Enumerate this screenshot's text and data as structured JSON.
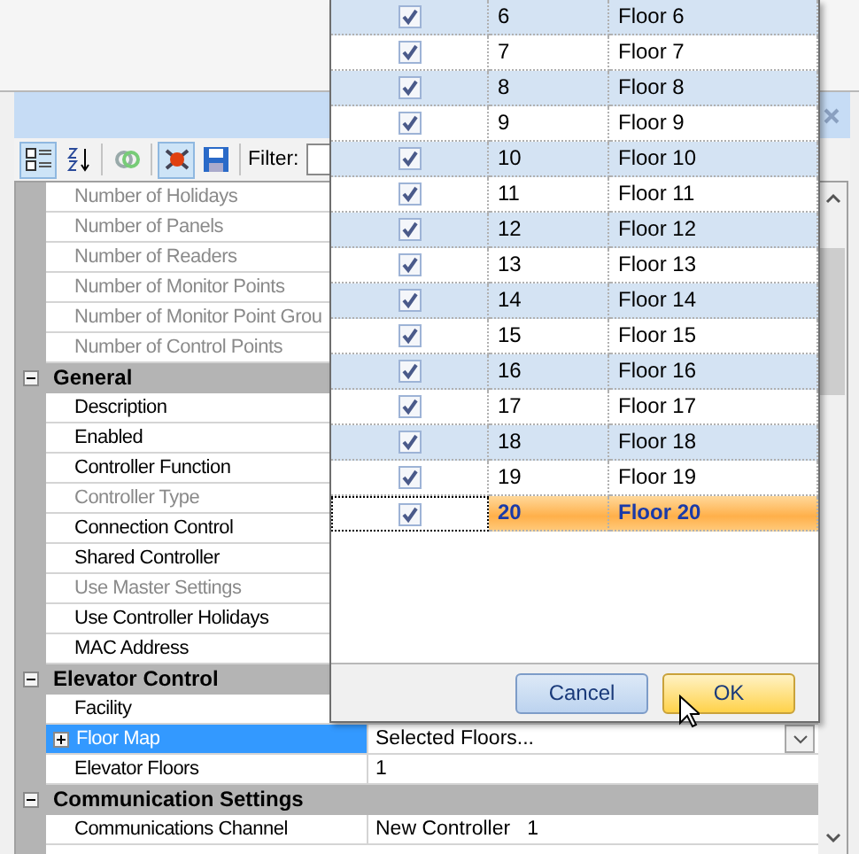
{
  "toolbar": {
    "buttons": [
      {
        "kind": "categorized",
        "selected": true
      },
      {
        "kind": "alphabetical",
        "selected": false
      },
      {
        "kind": "link",
        "selected": false
      },
      {
        "kind": "tools",
        "selected": true
      },
      {
        "kind": "save",
        "selected": false
      }
    ],
    "filter_label": "Filter:"
  },
  "property_grid": {
    "rows": [
      {
        "kind": "property",
        "label": "Number of Holidays",
        "disabled": true,
        "selected": false
      },
      {
        "kind": "property",
        "label": "Number of Panels",
        "disabled": true,
        "selected": false
      },
      {
        "kind": "property",
        "label": "Number of Readers",
        "disabled": true,
        "selected": false
      },
      {
        "kind": "property",
        "label": "Number of Monitor Points",
        "disabled": true,
        "selected": false
      },
      {
        "kind": "property",
        "label": "Number of Monitor Point Grou",
        "disabled": true,
        "selected": false
      },
      {
        "kind": "property",
        "label": "Number of Control Points",
        "disabled": true,
        "selected": false
      },
      {
        "kind": "category",
        "label": "General",
        "expanded": true
      },
      {
        "kind": "property",
        "label": "Description",
        "disabled": false,
        "selected": false
      },
      {
        "kind": "property",
        "label": "Enabled",
        "disabled": false,
        "selected": false
      },
      {
        "kind": "property",
        "label": "Controller Function",
        "disabled": false,
        "selected": false
      },
      {
        "kind": "property",
        "label": "Controller Type",
        "disabled": true,
        "selected": false
      },
      {
        "kind": "property",
        "label": "Connection Control",
        "disabled": false,
        "selected": false
      },
      {
        "kind": "property",
        "label": "Shared Controller",
        "disabled": false,
        "selected": false
      },
      {
        "kind": "property",
        "label": "Use Master Settings",
        "disabled": true,
        "selected": false
      },
      {
        "kind": "property",
        "label": "Use Controller Holidays",
        "disabled": false,
        "selected": false
      },
      {
        "kind": "property",
        "label": "MAC Address",
        "disabled": false,
        "selected": false
      },
      {
        "kind": "category",
        "label": "Elevator Control",
        "expanded": true
      },
      {
        "kind": "property",
        "label": "Facility",
        "disabled": false,
        "selected": false
      },
      {
        "kind": "property",
        "label": "Floor Map",
        "disabled": false,
        "selected": true,
        "expanded": false,
        "value": "Selected Floors..."
      },
      {
        "kind": "property",
        "label": "Elevator Floors",
        "disabled": false,
        "selected": false,
        "value": "1"
      },
      {
        "kind": "category",
        "label": "Communication Settings",
        "expanded": true
      },
      {
        "kind": "property",
        "label": "Communications Channel",
        "disabled": false,
        "selected": false,
        "value": "New Controller   1"
      }
    ]
  },
  "floor_popup": {
    "rows": [
      {
        "checked": true,
        "number": "6",
        "name": "Floor 6",
        "selected": false
      },
      {
        "checked": true,
        "number": "7",
        "name": "Floor 7",
        "selected": false
      },
      {
        "checked": true,
        "number": "8",
        "name": "Floor 8",
        "selected": false
      },
      {
        "checked": true,
        "number": "9",
        "name": "Floor 9",
        "selected": false
      },
      {
        "checked": true,
        "number": "10",
        "name": "Floor 10",
        "selected": false
      },
      {
        "checked": true,
        "number": "11",
        "name": "Floor 11",
        "selected": false
      },
      {
        "checked": true,
        "number": "12",
        "name": "Floor 12",
        "selected": false
      },
      {
        "checked": true,
        "number": "13",
        "name": "Floor 13",
        "selected": false
      },
      {
        "checked": true,
        "number": "14",
        "name": "Floor 14",
        "selected": false
      },
      {
        "checked": true,
        "number": "15",
        "name": "Floor 15",
        "selected": false
      },
      {
        "checked": true,
        "number": "16",
        "name": "Floor 16",
        "selected": false
      },
      {
        "checked": true,
        "number": "17",
        "name": "Floor 17",
        "selected": false
      },
      {
        "checked": true,
        "number": "18",
        "name": "Floor 18",
        "selected": false
      },
      {
        "checked": true,
        "number": "19",
        "name": "Floor 19",
        "selected": false
      },
      {
        "checked": true,
        "number": "20",
        "name": "Floor 20",
        "selected": true
      }
    ],
    "buttons": [
      {
        "label": "Cancel",
        "hovered": false
      },
      {
        "label": "OK",
        "hovered": true
      }
    ]
  }
}
